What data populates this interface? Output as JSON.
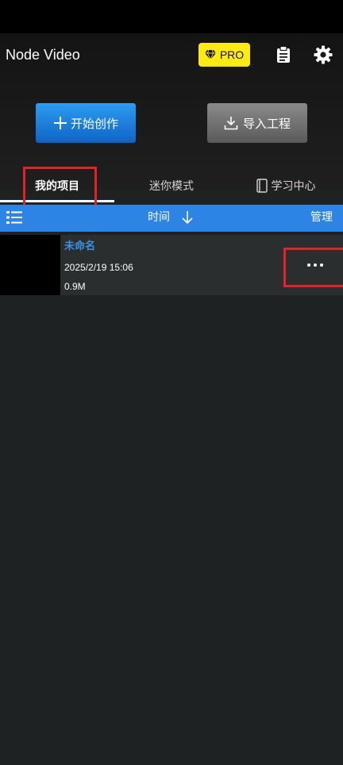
{
  "app": {
    "title": "Node Video",
    "pro_label": "PRO"
  },
  "icons": {
    "pro": "diamond-icon",
    "clipboard": "clipboard-icon",
    "settings": "gear-icon",
    "create": "plus-icon",
    "import": "download-icon",
    "learn": "book-icon",
    "list": "list-icon",
    "sort": "arrow-down-icon",
    "more": "more-dots-icon"
  },
  "actions": {
    "create_label": "开始创作",
    "import_label": "导入工程"
  },
  "tabs": [
    {
      "label": "我的项目",
      "active": true
    },
    {
      "label": "迷你模式",
      "active": false
    },
    {
      "label": "学习中心",
      "active": false
    }
  ],
  "sortbar": {
    "sort_label": "时间",
    "manage_label": "管理"
  },
  "projects": [
    {
      "name": "未命名",
      "date": "2025/2/19 15:06",
      "size": "0.9M"
    }
  ],
  "colors": {
    "accent_blue": "#2d84e4",
    "pro_yellow": "#ffeb10",
    "highlight_red": "#e4202b",
    "background": "#1e2222"
  }
}
